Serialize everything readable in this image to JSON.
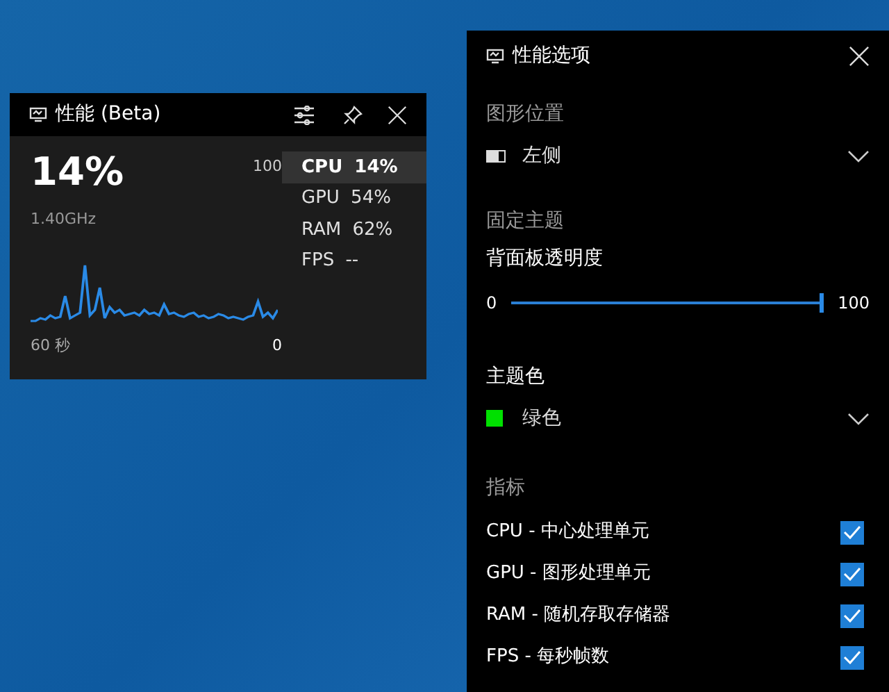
{
  "widget": {
    "title": "性能 (Beta)",
    "big_value": "14%",
    "max_label": "100",
    "frequency": "1.40GHz",
    "time_label": "60 秒",
    "min_label": "0",
    "metrics": [
      {
        "text": "CPU 14%",
        "selected": true
      },
      {
        "text": "GPU 54%",
        "selected": false
      },
      {
        "text": "RAM 62%",
        "selected": false
      },
      {
        "text": "FPS --",
        "selected": false
      }
    ]
  },
  "options": {
    "title": "性能选项",
    "graph_position": {
      "label": "图形位置",
      "value": "左侧"
    },
    "pinned_theme": {
      "label": "固定主题"
    },
    "opacity": {
      "label": "背面板透明度",
      "min": "0",
      "max": "100",
      "level": 1
    },
    "theme_color": {
      "label": "主题色",
      "value": "绿色",
      "color": "#00e000"
    },
    "metrics": {
      "label": "指标",
      "items": [
        {
          "label": "CPU - 中心处理单元",
          "checked": true
        },
        {
          "label": "GPU - 图形处理单元",
          "checked": true
        },
        {
          "label": "RAM - 随机存取存储器",
          "checked": true
        },
        {
          "label": "FPS - 每秒帧数",
          "checked": true
        }
      ]
    }
  }
}
